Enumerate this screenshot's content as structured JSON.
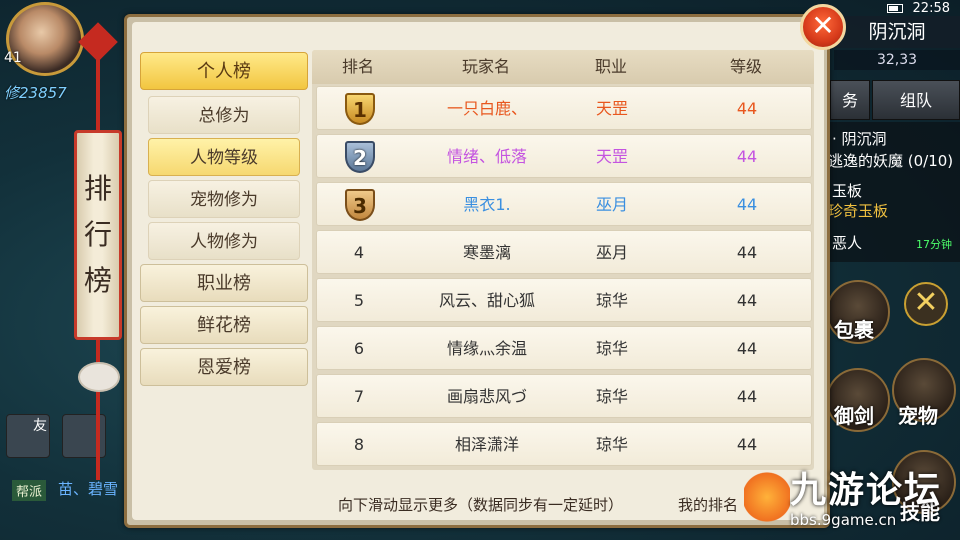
{
  "hud": {
    "level": "41",
    "power": "修23857",
    "time": "22:58",
    "map_name": "阴沉洞",
    "coords": "32,33",
    "tab_task": "务",
    "tab_team": "组队",
    "quest_lines": [
      "· 阴沉洞",
      "逃逸的妖魔 (0/10)",
      "玉板",
      "珍奇玉板",
      "恶人"
    ],
    "quest_timer": "17分钟",
    "btn_bag": "包裹",
    "btn_sword": "御剑",
    "btn_pet": "宠物",
    "btn_skill": "技能",
    "btn_friend": "友",
    "guild_tag": "帮派",
    "guild_text": "苗、碧雪"
  },
  "watermark": {
    "title": "九游论坛",
    "url": "bbs.9game.cn"
  },
  "scroll_title": [
    "排",
    "行",
    "榜"
  ],
  "close_label": "✕",
  "nav": {
    "main": [
      {
        "label": "个人榜",
        "active": true
      },
      {
        "label": "职业榜",
        "active": false
      },
      {
        "label": "鲜花榜",
        "active": false
      },
      {
        "label": "恩爱榜",
        "active": false
      }
    ],
    "sub": [
      {
        "label": "总修为",
        "active": false
      },
      {
        "label": "人物等级",
        "active": true
      },
      {
        "label": "宠物修为",
        "active": false
      },
      {
        "label": "人物修为",
        "active": false
      }
    ]
  },
  "table": {
    "headers": [
      "排名",
      "玩家名",
      "职业",
      "等级"
    ],
    "rows": [
      {
        "rank": "1",
        "name": "一只白鹿、",
        "class": "天罡",
        "level": "44",
        "color": "#e8571e"
      },
      {
        "rank": "2",
        "name": "情绪、低落",
        "class": "天罡",
        "level": "44",
        "color": "#c454e0"
      },
      {
        "rank": "3",
        "name": "黑衣1.",
        "class": "巫月",
        "level": "44",
        "color": "#3a8fe0"
      },
      {
        "rank": "4",
        "name": "寒墨漓",
        "class": "巫月",
        "level": "44",
        "color": "#333333"
      },
      {
        "rank": "5",
        "name": "风云、甜心狐",
        "class": "琼华",
        "level": "44",
        "color": "#333333"
      },
      {
        "rank": "6",
        "name": "情缘灬余温",
        "class": "琼华",
        "level": "44",
        "color": "#333333"
      },
      {
        "rank": "7",
        "name": "画扇悲风づ",
        "class": "琼华",
        "level": "44",
        "color": "#333333"
      },
      {
        "rank": "8",
        "name": "相泽潇洋",
        "class": "琼华",
        "level": "44",
        "color": "#333333"
      }
    ]
  },
  "footer": {
    "hint": "向下滑动显示更多（数据同步有一定延时）",
    "my_rank": "我的排名"
  }
}
